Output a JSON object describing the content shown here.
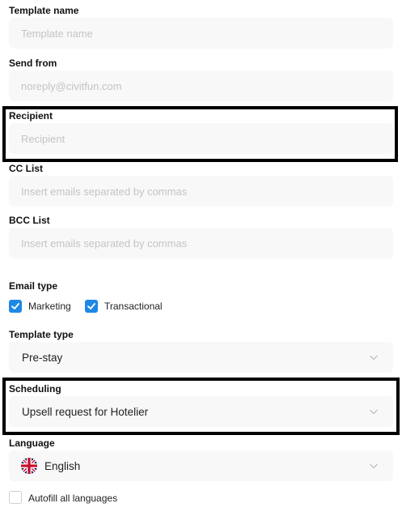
{
  "form": {
    "template_name": {
      "label": "Template name",
      "placeholder": "Template name"
    },
    "send_from": {
      "label": "Send from",
      "placeholder": "noreply@civitfun.com"
    },
    "recipient": {
      "label": "Recipient",
      "placeholder": "Recipient"
    },
    "cc_list": {
      "label": "CC List",
      "placeholder": "Insert emails separated by commas"
    },
    "bcc_list": {
      "label": "BCC List",
      "placeholder": "Insert emails separated by commas"
    },
    "email_type": {
      "label": "Email type",
      "options": [
        {
          "label": "Marketing",
          "checked": true
        },
        {
          "label": "Transactional",
          "checked": true
        }
      ]
    },
    "template_type": {
      "label": "Template type",
      "value": "Pre-stay"
    },
    "scheduling": {
      "label": "Scheduling",
      "value": "Upsell request for Hotelier"
    },
    "language": {
      "label": "Language",
      "value": "English",
      "flag_icon": "uk-flag-icon"
    },
    "autofill": {
      "label": "Autofill all languages",
      "checked": false
    }
  },
  "colors": {
    "accent": "#1e88e5",
    "field_bg": "#f8f8f8",
    "placeholder": "#c4c4c4",
    "highlight_border": "#000000"
  }
}
